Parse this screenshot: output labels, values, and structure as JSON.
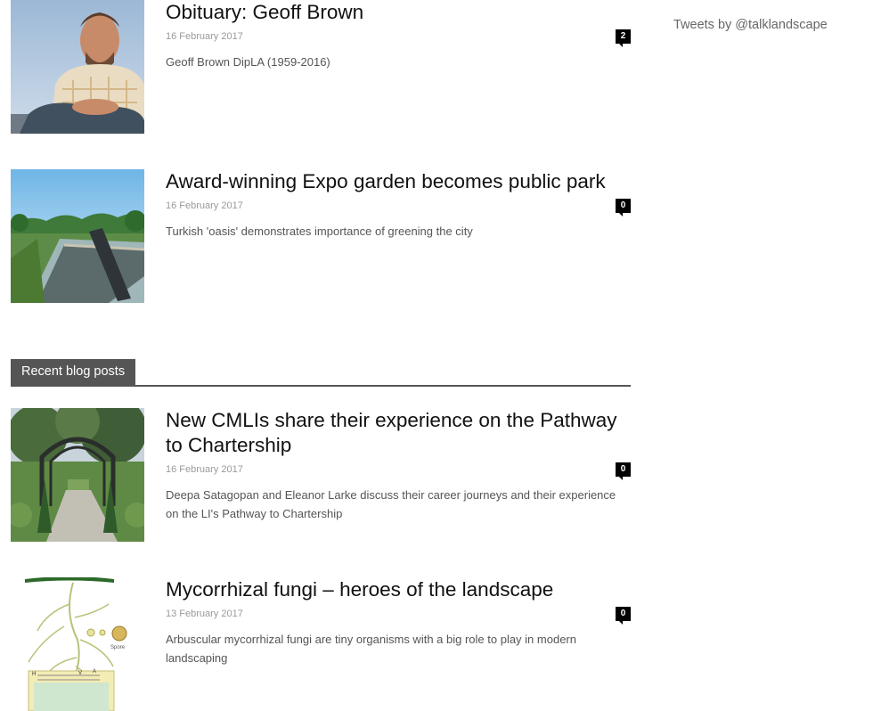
{
  "articles": [
    {
      "title": "Obituary: Geoff Brown",
      "date": "16 February 2017",
      "comments": "2",
      "excerpt": "Geoff Brown DipLA (1959-2016)",
      "image_icon": "portrait-photo"
    },
    {
      "title": "Award-winning Expo garden becomes public park",
      "date": "16 February 2017",
      "comments": "0",
      "excerpt": "Turkish 'oasis' demonstrates importance of greening the city",
      "image_icon": "garden-photo"
    }
  ],
  "blog": {
    "heading": "Recent blog posts",
    "posts": [
      {
        "title": "New CMLIs share their experience on the Pathway to Chartership",
        "date": "16 February 2017",
        "comments": "0",
        "excerpt": "Deepa Satagopan and Eleanor Larke discuss their career journeys and their experience on the LI's Pathway to Chartership",
        "image_icon": "arch-garden-photo"
      },
      {
        "title": "Mycorrhizal fungi – heroes of the landscape",
        "date": "13 February 2017",
        "comments": "0",
        "excerpt": "Arbuscular mycorrhizal fungi are tiny organisms with a big role to play in modern landscaping",
        "image_icon": "fungi-diagram",
        "diagram_labels": {
          "spore": "Spore",
          "h": "H",
          "v": "V",
          "a": "A"
        }
      }
    ]
  },
  "sidebar": {
    "tweets_link": "Tweets by @talklandscape"
  },
  "colors": {
    "section_bar": "#555555",
    "badge": "#000000",
    "meta_text": "#9a9a9a"
  }
}
